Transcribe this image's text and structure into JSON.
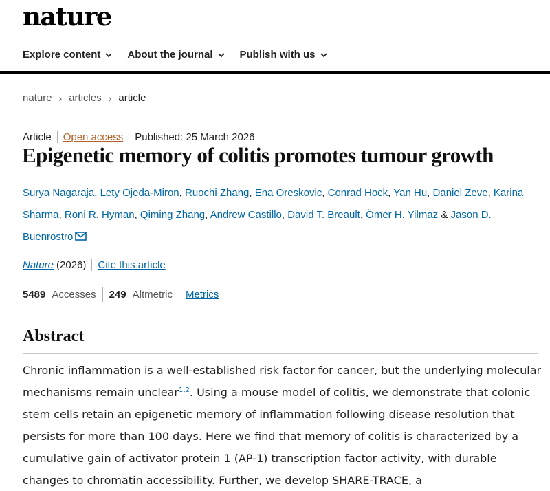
{
  "header": {
    "logo": "nature",
    "nav": [
      {
        "label": "Explore content"
      },
      {
        "label": "About the journal"
      },
      {
        "label": "Publish with us"
      }
    ]
  },
  "breadcrumb": [
    {
      "label": "nature"
    },
    {
      "label": "articles"
    },
    {
      "label": "article"
    }
  ],
  "article": {
    "type": "Article",
    "access": "Open access",
    "published": "Published: 25 March 2026",
    "title": "Epigenetic memory of colitis promotes tumour growth",
    "authors": [
      "Surya Nagaraja",
      "Lety Ojeda-Miron",
      "Ruochi Zhang",
      "Ena Oreskovic",
      "Conrad Hock",
      "Yan Hu",
      "Daniel Zeve",
      "Karina Sharma",
      "Roni R. Hyman",
      "Qiming Zhang",
      "Andrew Castillo",
      "David T. Breault",
      "Ömer H. Yilmaz",
      "Jason D. Buenrostro"
    ],
    "journal": "Nature",
    "year": "(2026)",
    "cite_label": "Cite this article",
    "accesses_count": "5489",
    "accesses_label": "Accesses",
    "altmetric_count": "249",
    "altmetric_label": "Altmetric",
    "metrics_label": "Metrics"
  },
  "abstract": {
    "heading": "Abstract",
    "text_1": "Chronic inflammation is a well-established risk factor for cancer, but the underlying molecular mechanisms remain unclear",
    "ref_1": "1",
    "ref_sep": ",",
    "ref_2": "2",
    "text_2": ". Using a mouse model of colitis, we demonstrate that colonic stem cells retain an epigenetic memory of inflammation following disease resolution that persists for more than 100 days. Here we find that memory of colitis is characterized by a cumulative gain of activator protein 1 (AP-1) transcription factor activity, with durable changes to chromatin accessibility. Further, we develop SHARE-TRACE, a"
  }
}
